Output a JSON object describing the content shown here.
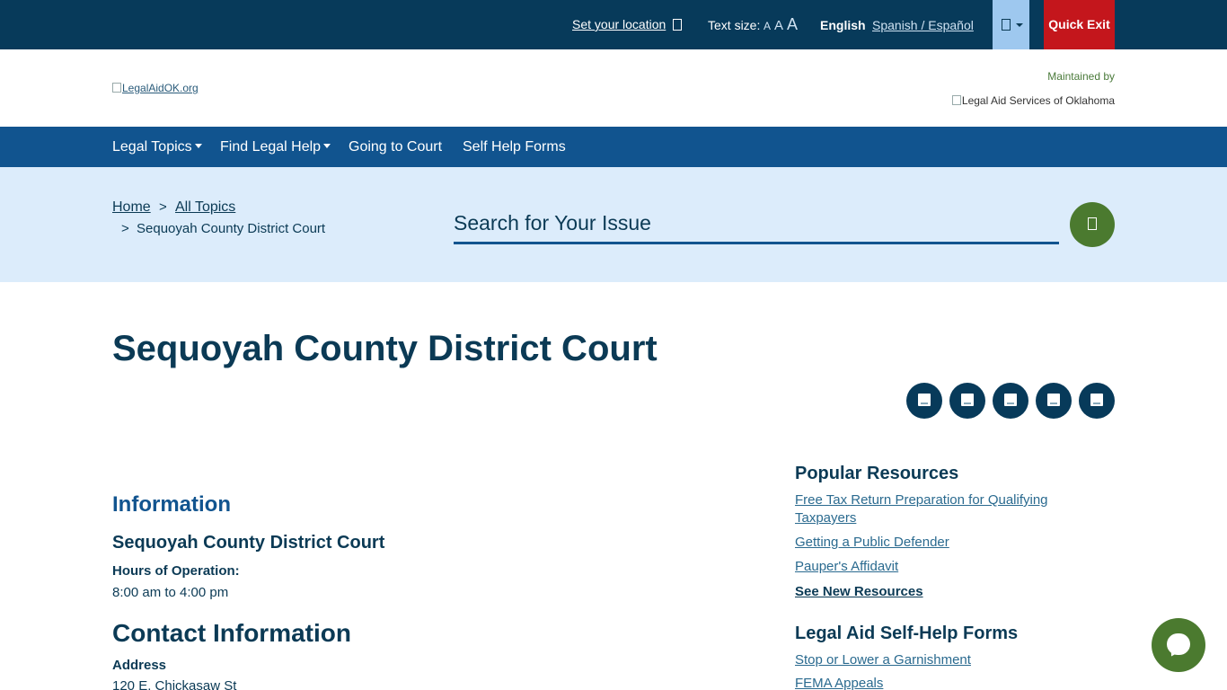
{
  "topbar": {
    "set_location": "Set your location",
    "text_size_label": "Text size:",
    "text_size_options": [
      "A",
      "A",
      "A"
    ],
    "lang_current": "English",
    "lang_alt": "Spanish / Español",
    "quick_exit": "Quick Exit"
  },
  "header": {
    "logo_alt": "LegalAidOK.org",
    "maintained_by": "Maintained by",
    "partner_alt": "Legal Aid Services of Oklahoma"
  },
  "nav": {
    "items": [
      {
        "label": "Legal Topics",
        "dropdown": true
      },
      {
        "label": "Find Legal Help",
        "dropdown": true
      },
      {
        "label": "Going to Court",
        "dropdown": false
      },
      {
        "label": "Self Help Forms",
        "dropdown": false
      }
    ]
  },
  "breadcrumb": {
    "home": "Home",
    "sep": ">",
    "all_topics": "All Topics",
    "current": "Sequoyah County District Court"
  },
  "search": {
    "placeholder": "Search for Your Issue"
  },
  "page": {
    "title": "Sequoyah County District Court"
  },
  "main": {
    "info_heading": "Information",
    "court_name": "Sequoyah County District Court",
    "hours_label": "Hours of Operation:",
    "hours_value": "8:00 am to 4:00 pm",
    "contact_heading": "Contact Information",
    "address_label": "Address",
    "address_value": "120 E. Chickasaw St"
  },
  "sidebar": {
    "popular_heading": "Popular Resources",
    "popular_links": [
      "Free Tax Return Preparation for Qualifying Taxpayers",
      "Getting a Public Defender",
      "Pauper's Affidavit"
    ],
    "see_new": "See New Resources",
    "forms_heading": "Legal Aid Self-Help Forms",
    "forms_links": [
      "Stop or Lower a Garnishment",
      "FEMA Appeals"
    ]
  },
  "colors": {
    "topbar_bg": "#073a5a",
    "nav_bg": "#11548f",
    "band_bg": "#dcecfb",
    "quick_exit_bg": "#c4161c",
    "accent_green": "#4b7a2f",
    "heading_text": "#0b3a55"
  }
}
